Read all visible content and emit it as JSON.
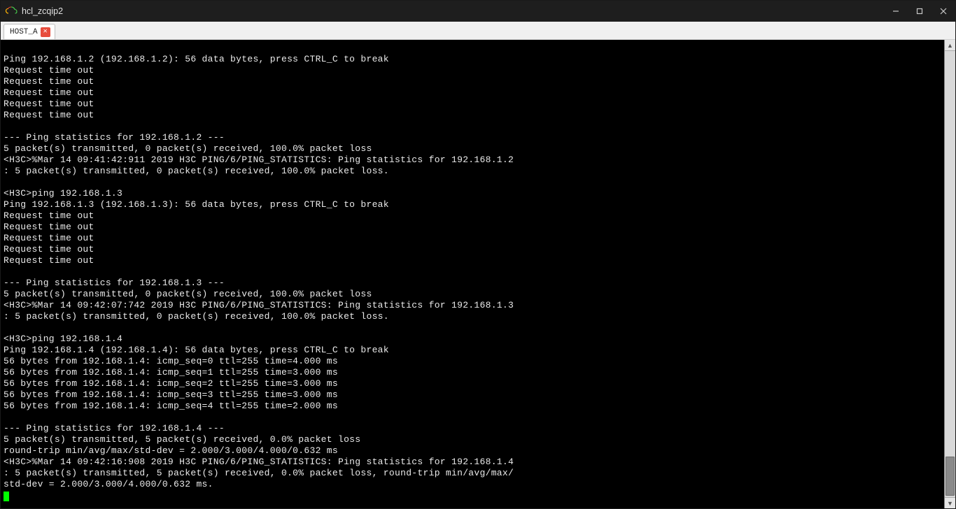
{
  "window": {
    "title": "hcl_zcqip2"
  },
  "tab": {
    "label": "HOST_A"
  },
  "terminal": {
    "lines": [
      "",
      "Ping 192.168.1.2 (192.168.1.2): 56 data bytes, press CTRL_C to break",
      "Request time out",
      "Request time out",
      "Request time out",
      "Request time out",
      "Request time out",
      "",
      "--- Ping statistics for 192.168.1.2 ---",
      "5 packet(s) transmitted, 0 packet(s) received, 100.0% packet loss",
      "<H3C>%Mar 14 09:41:42:911 2019 H3C PING/6/PING_STATISTICS: Ping statistics for 192.168.1.2",
      ": 5 packet(s) transmitted, 0 packet(s) received, 100.0% packet loss.",
      "",
      "<H3C>ping 192.168.1.3",
      "Ping 192.168.1.3 (192.168.1.3): 56 data bytes, press CTRL_C to break",
      "Request time out",
      "Request time out",
      "Request time out",
      "Request time out",
      "Request time out",
      "",
      "--- Ping statistics for 192.168.1.3 ---",
      "5 packet(s) transmitted, 0 packet(s) received, 100.0% packet loss",
      "<H3C>%Mar 14 09:42:07:742 2019 H3C PING/6/PING_STATISTICS: Ping statistics for 192.168.1.3",
      ": 5 packet(s) transmitted, 0 packet(s) received, 100.0% packet loss.",
      "",
      "<H3C>ping 192.168.1.4",
      "Ping 192.168.1.4 (192.168.1.4): 56 data bytes, press CTRL_C to break",
      "56 bytes from 192.168.1.4: icmp_seq=0 ttl=255 time=4.000 ms",
      "56 bytes from 192.168.1.4: icmp_seq=1 ttl=255 time=3.000 ms",
      "56 bytes from 192.168.1.4: icmp_seq=2 ttl=255 time=3.000 ms",
      "56 bytes from 192.168.1.4: icmp_seq=3 ttl=255 time=3.000 ms",
      "56 bytes from 192.168.1.4: icmp_seq=4 ttl=255 time=2.000 ms",
      "",
      "--- Ping statistics for 192.168.1.4 ---",
      "5 packet(s) transmitted, 5 packet(s) received, 0.0% packet loss",
      "round-trip min/avg/max/std-dev = 2.000/3.000/4.000/0.632 ms",
      "<H3C>%Mar 14 09:42:16:908 2019 H3C PING/6/PING_STATISTICS: Ping statistics for 192.168.1.4",
      ": 5 packet(s) transmitted, 5 packet(s) received, 0.0% packet loss, round-trip min/avg/max/",
      "std-dev = 2.000/3.000/4.000/0.632 ms."
    ]
  }
}
